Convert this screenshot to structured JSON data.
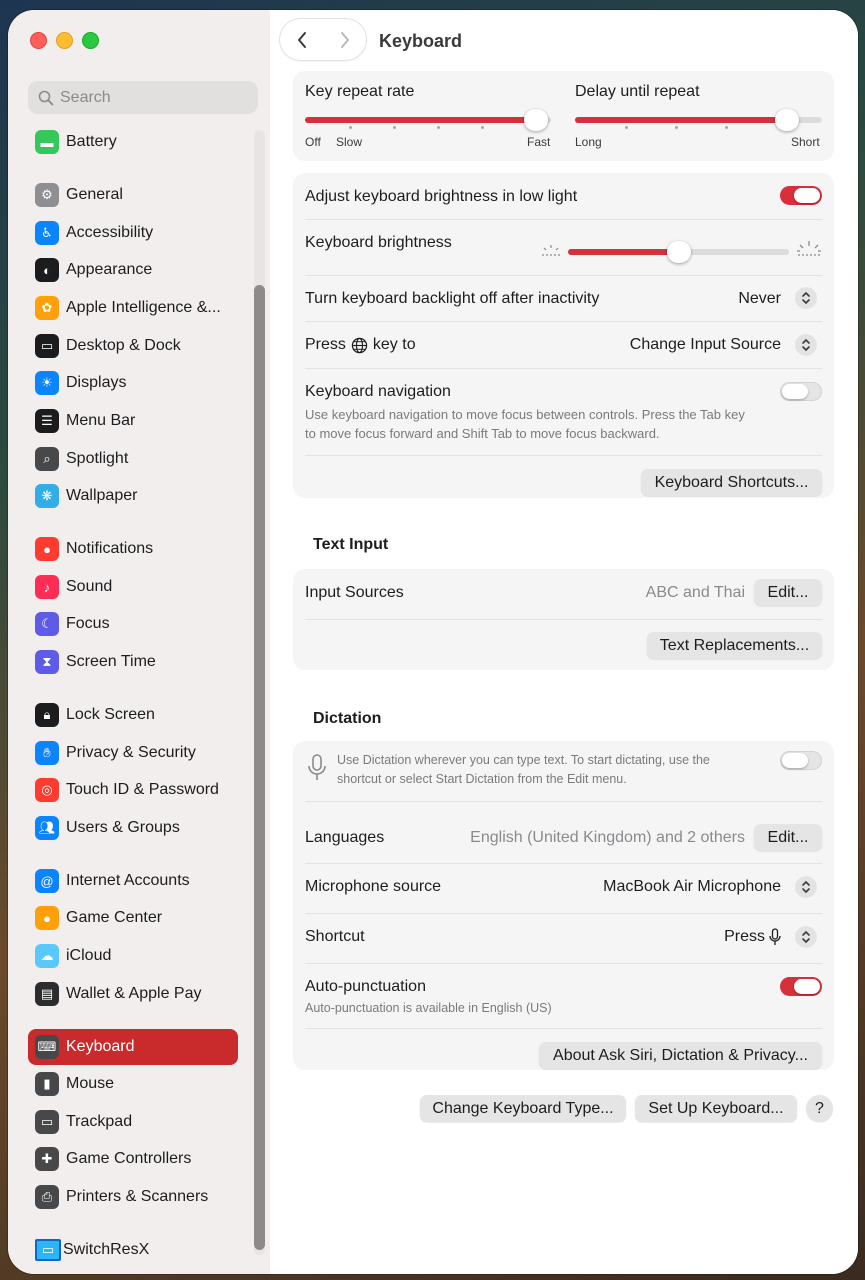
{
  "window": {
    "title": "Keyboard"
  },
  "sidebar": {
    "search_placeholder": "Search",
    "items": [
      {
        "label": "Battery",
        "icon": "battery-icon",
        "color": "#35c759"
      },
      {
        "label": "General",
        "icon": "gear-icon",
        "color": "#8e8e93"
      },
      {
        "label": "Accessibility",
        "icon": "accessibility-icon",
        "color": "#0a84ff"
      },
      {
        "label": "Appearance",
        "icon": "appearance-icon",
        "color": "#1c1c1e"
      },
      {
        "label": "Apple Intelligence &...",
        "icon": "apple-intelligence-icon",
        "color": "#ff9f0a"
      },
      {
        "label": "Desktop & Dock",
        "icon": "dock-icon",
        "color": "#1c1c1e"
      },
      {
        "label": "Displays",
        "icon": "displays-icon",
        "color": "#0a84ff"
      },
      {
        "label": "Menu Bar",
        "icon": "menu-bar-icon",
        "color": "#1c1c1e"
      },
      {
        "label": "Spotlight",
        "icon": "spotlight-icon",
        "color": "#48484a"
      },
      {
        "label": "Wallpaper",
        "icon": "wallpaper-icon",
        "color": "#32ade6"
      },
      {
        "label": "Notifications",
        "icon": "notifications-icon",
        "color": "#ff3b30"
      },
      {
        "label": "Sound",
        "icon": "sound-icon",
        "color": "#ff2d55"
      },
      {
        "label": "Focus",
        "icon": "focus-icon",
        "color": "#5e5ce6"
      },
      {
        "label": "Screen Time",
        "icon": "screen-time-icon",
        "color": "#5e5ce6"
      },
      {
        "label": "Lock Screen",
        "icon": "lock-icon",
        "color": "#1c1c1e"
      },
      {
        "label": "Privacy & Security",
        "icon": "privacy-hand-icon",
        "color": "#0a84ff"
      },
      {
        "label": "Touch ID & Password",
        "icon": "fingerprint-icon",
        "color": "#ff3b30"
      },
      {
        "label": "Users & Groups",
        "icon": "users-icon",
        "color": "#0a84ff"
      },
      {
        "label": "Internet Accounts",
        "icon": "at-icon",
        "color": "#0a84ff"
      },
      {
        "label": "Game Center",
        "icon": "game-center-icon",
        "color": "#ff9f0a"
      },
      {
        "label": "iCloud",
        "icon": "icloud-icon",
        "color": "#5ac8fa"
      },
      {
        "label": "Wallet & Apple Pay",
        "icon": "wallet-icon",
        "color": "#2c2c2e"
      },
      {
        "label": "Keyboard",
        "icon": "keyboard-icon",
        "color": "#48484a"
      },
      {
        "label": "Mouse",
        "icon": "mouse-icon",
        "color": "#48484a"
      },
      {
        "label": "Trackpad",
        "icon": "trackpad-icon",
        "color": "#48484a"
      },
      {
        "label": "Game Controllers",
        "icon": "game-controller-icon",
        "color": "#48484a"
      },
      {
        "label": "Printers & Scanners",
        "icon": "printer-icon",
        "color": "#48484a"
      },
      {
        "label": "SwitchResX",
        "icon": "monitor-icon",
        "color": "#0a84ff"
      }
    ]
  },
  "repeat": {
    "rate_label": "Key repeat rate",
    "rate_ticks": [
      "Off",
      "Slow",
      "Fast"
    ],
    "rate_value": 0.94,
    "delay_label": "Delay until repeat",
    "delay_ticks": [
      "Long",
      "Short"
    ],
    "delay_value": 0.86
  },
  "keyboard_settings": {
    "adjust_brightness_label": "Adjust keyboard brightness in low light",
    "adjust_brightness_on": true,
    "brightness_label": "Keyboard brightness",
    "brightness_value": 0.5,
    "backlight_label": "Turn keyboard backlight off after inactivity",
    "backlight_value": "Never",
    "press_key_label_pre": "Press",
    "press_key_label_post": "key to",
    "press_key_value": "Change Input Source",
    "nav_label": "Keyboard navigation",
    "nav_desc": "Use keyboard navigation to move focus between controls. Press the Tab key to move focus forward and Shift Tab to move focus backward.",
    "nav_on": false,
    "shortcuts_button": "Keyboard Shortcuts..."
  },
  "text_input": {
    "heading": "Text Input",
    "sources_label": "Input Sources",
    "sources_value": "ABC and Thai",
    "edit_button": "Edit...",
    "replacements_button": "Text Replacements..."
  },
  "dictation": {
    "heading": "Dictation",
    "desc": "Use Dictation wherever you can type text. To start dictating, use the shortcut or select Start Dictation from the Edit menu.",
    "enabled": false,
    "languages_label": "Languages",
    "languages_value": "English (United Kingdom) and 2 others",
    "edit_button": "Edit...",
    "mic_label": "Microphone source",
    "mic_value": "MacBook Air Microphone",
    "shortcut_label": "Shortcut",
    "shortcut_value": "Press",
    "autopunct_label": "Auto-punctuation",
    "autopunct_desc": "Auto-punctuation is available in English (US)",
    "autopunct_on": true,
    "about_button": "About Ask Siri, Dictation & Privacy..."
  },
  "footer": {
    "change_type_button": "Change Keyboard Type...",
    "setup_button": "Set Up Keyboard...",
    "help_button": "?"
  },
  "colors": {
    "accent": "#d6303a",
    "sidebar_active": "#c92a2c"
  }
}
